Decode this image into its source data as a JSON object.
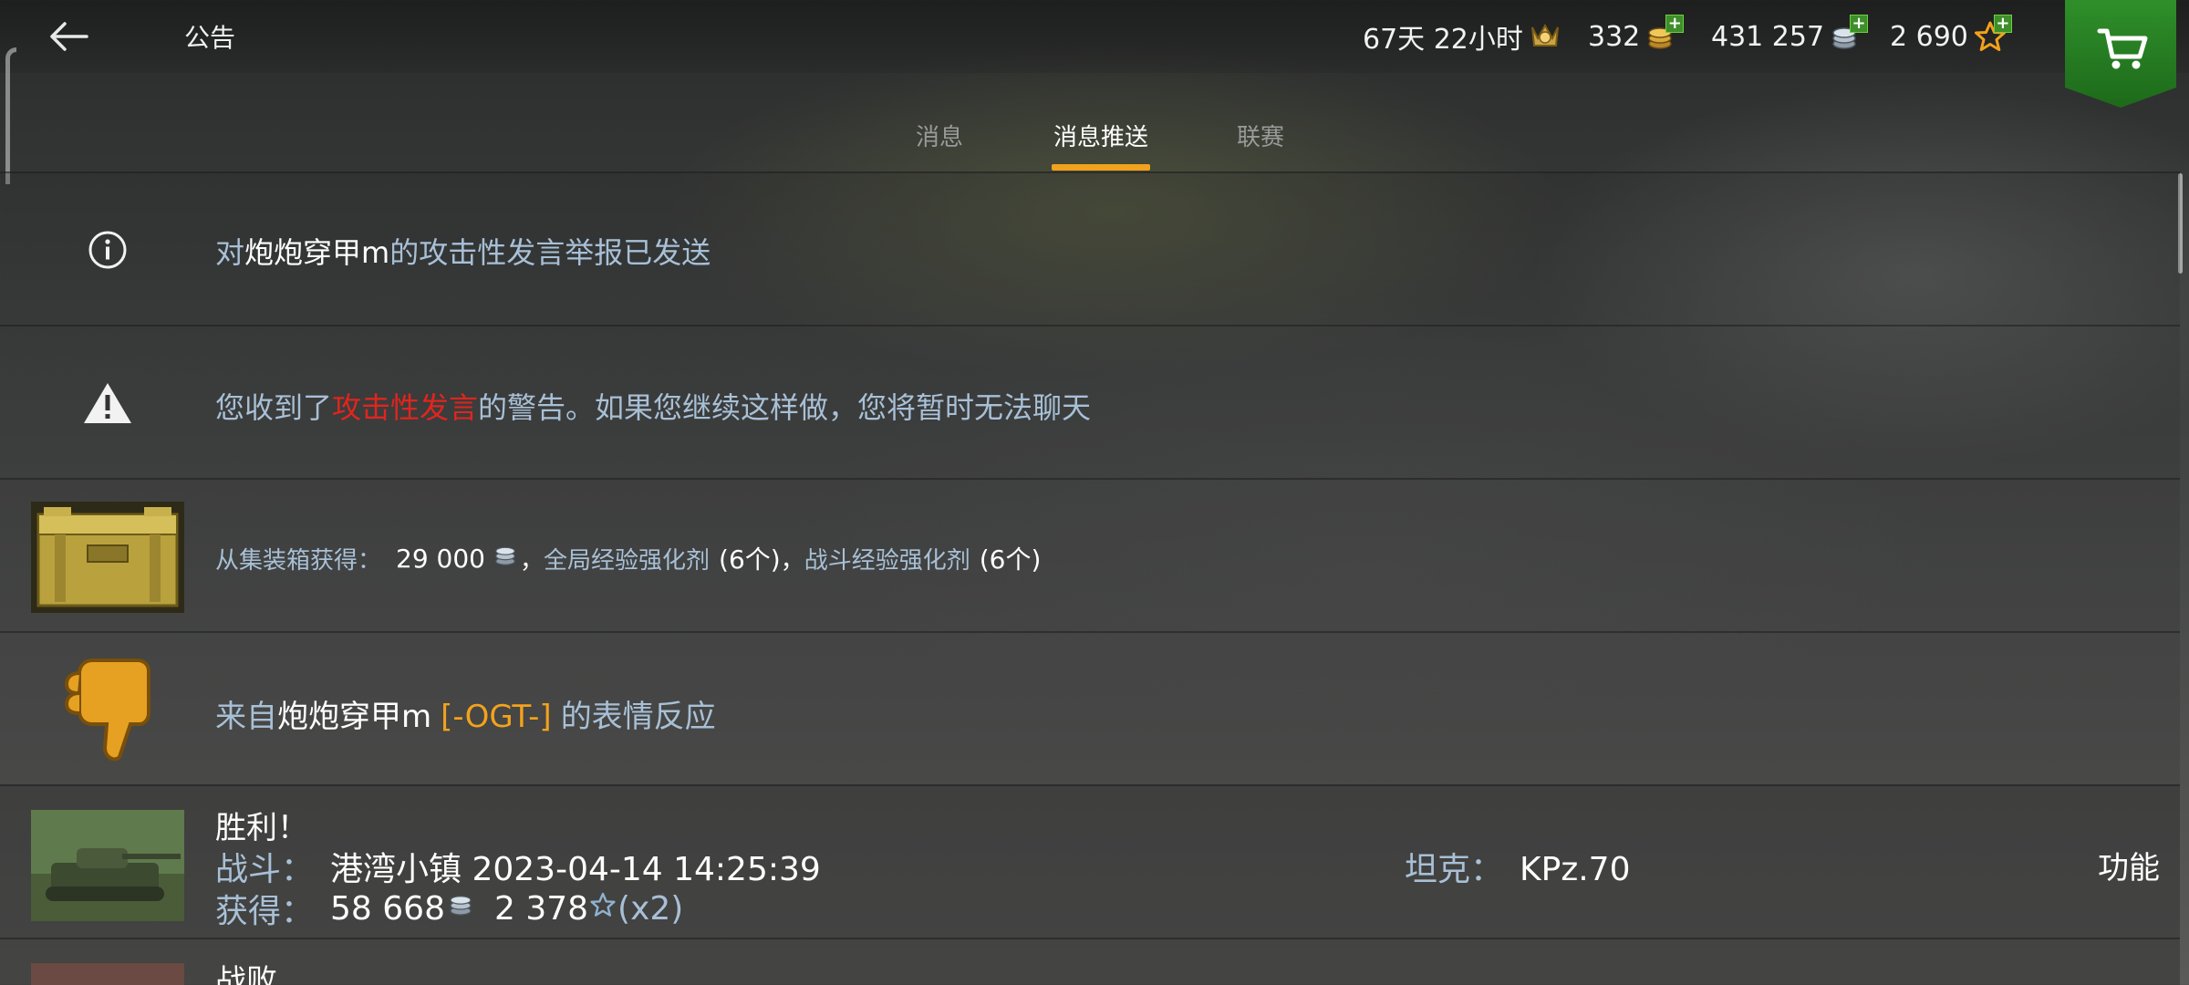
{
  "header": {
    "title": "公告",
    "premium_time": "67天 22小时",
    "gold": "332",
    "credits": "431 257",
    "free_xp": "2 690",
    "plus_symbol": "+"
  },
  "tabs": [
    {
      "label": "消息",
      "active": false
    },
    {
      "label": "消息推送",
      "active": true
    },
    {
      "label": "联赛",
      "active": false
    }
  ],
  "messages": {
    "report": {
      "prefix": "对",
      "player": "炮炮穿甲m",
      "suffix": "的攻击性发言举报已发送"
    },
    "warning": {
      "prefix": "您收到了",
      "highlight": "攻击性发言",
      "suffix": "的警告。如果您继续这样做，您将暂时无法聊天"
    },
    "container": {
      "label": "从集装箱获得：",
      "credits": "29 000",
      "sep1": "，",
      "item1": "全局经验强化剂",
      "qty1": "(6个)",
      "sep2": "，",
      "item2": "战斗经验强化剂",
      "qty2": "(6个)"
    },
    "reaction": {
      "prefix": "来自",
      "player": "炮炮穿甲m",
      "clan": "[-OGT-]",
      "suffix": "的表情反应"
    },
    "victory": {
      "title": "胜利！",
      "battle_label": "战斗：",
      "battle_value": "港湾小镇 2023-04-14 14:25:39",
      "earned_label": "获得：",
      "earned_credits": "58 668",
      "earned_xp": "2 378",
      "multiplier": "(x2)",
      "tank_label": "坦克：",
      "tank_value": "KPz.70",
      "action": "功能"
    },
    "defeat": {
      "title": "战败"
    }
  },
  "colors": {
    "accent": "#f2a21c",
    "label_blue": "#a8c0d6",
    "warning_red": "#e0251e",
    "shop_green": "#2f8f2a"
  }
}
